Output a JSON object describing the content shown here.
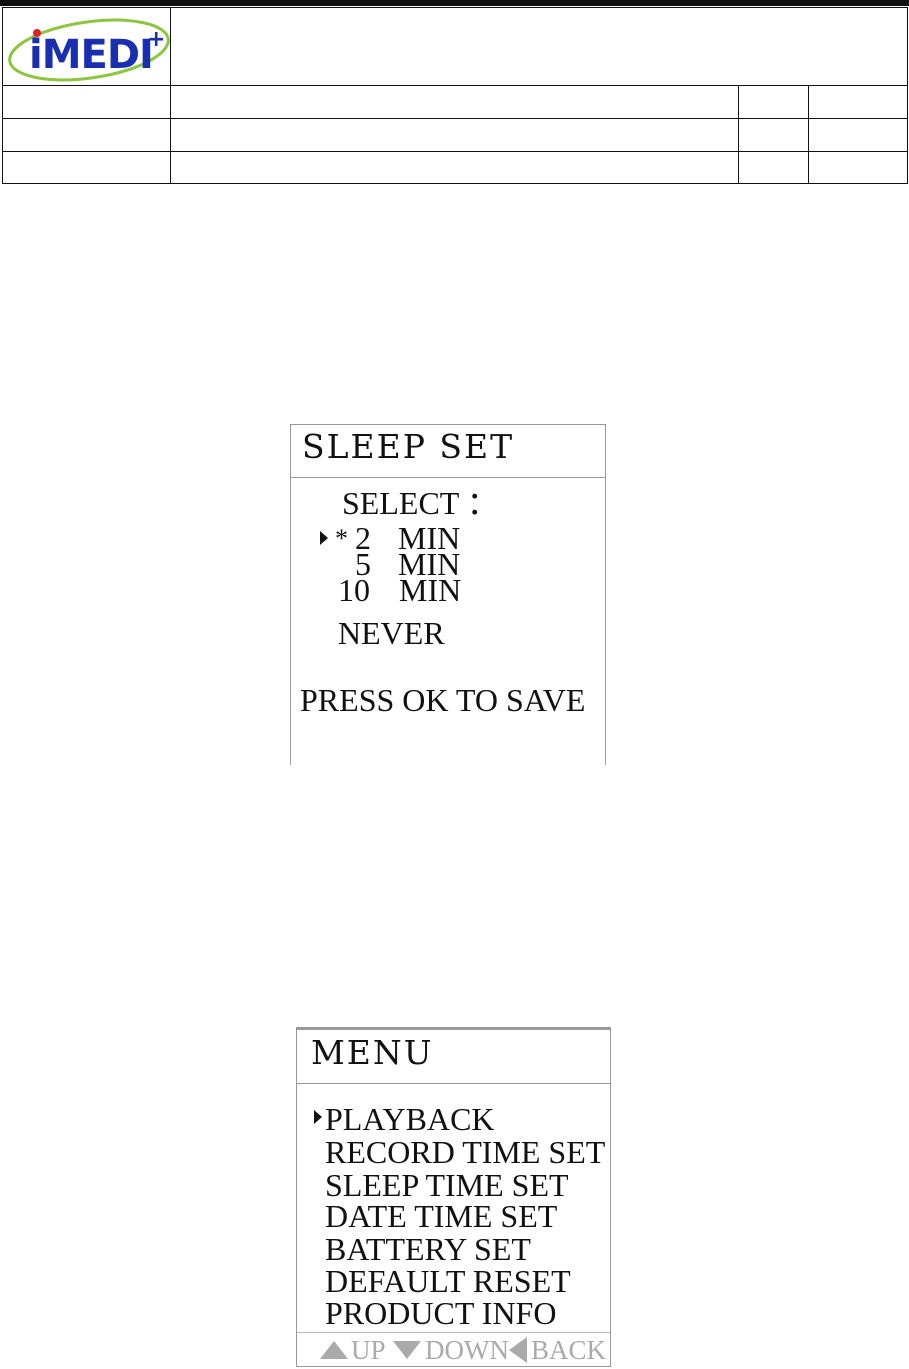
{
  "header": {
    "logo_text": "iMEDI+",
    "logo_colors": {
      "text": "#1a2fb0",
      "orbit": "#8cc63f",
      "dot": "#e31e24"
    }
  },
  "sleep_screen": {
    "title": "SLEEP SET",
    "prompt": "SELECT ：",
    "selected_marker": "*",
    "options": [
      {
        "value": "2",
        "unit": "MIN"
      },
      {
        "value": "5",
        "unit": "MIN"
      },
      {
        "value": "10",
        "unit": "MIN"
      },
      {
        "label": "NEVER"
      }
    ],
    "footer": "PRESS  OK  TO  SAVE"
  },
  "menu_screen": {
    "title": "MENU",
    "items": [
      "PLAYBACK",
      "RECORD  TIME  SET",
      "SLEEP  TIME  SET",
      "DATE  TIME  SET",
      "BATTERY SET",
      "DEFAULT  RESET",
      "PRODUCT  INFO"
    ],
    "nav": {
      "up": "UP",
      "down": "DOWN",
      "back": "BACK"
    }
  }
}
